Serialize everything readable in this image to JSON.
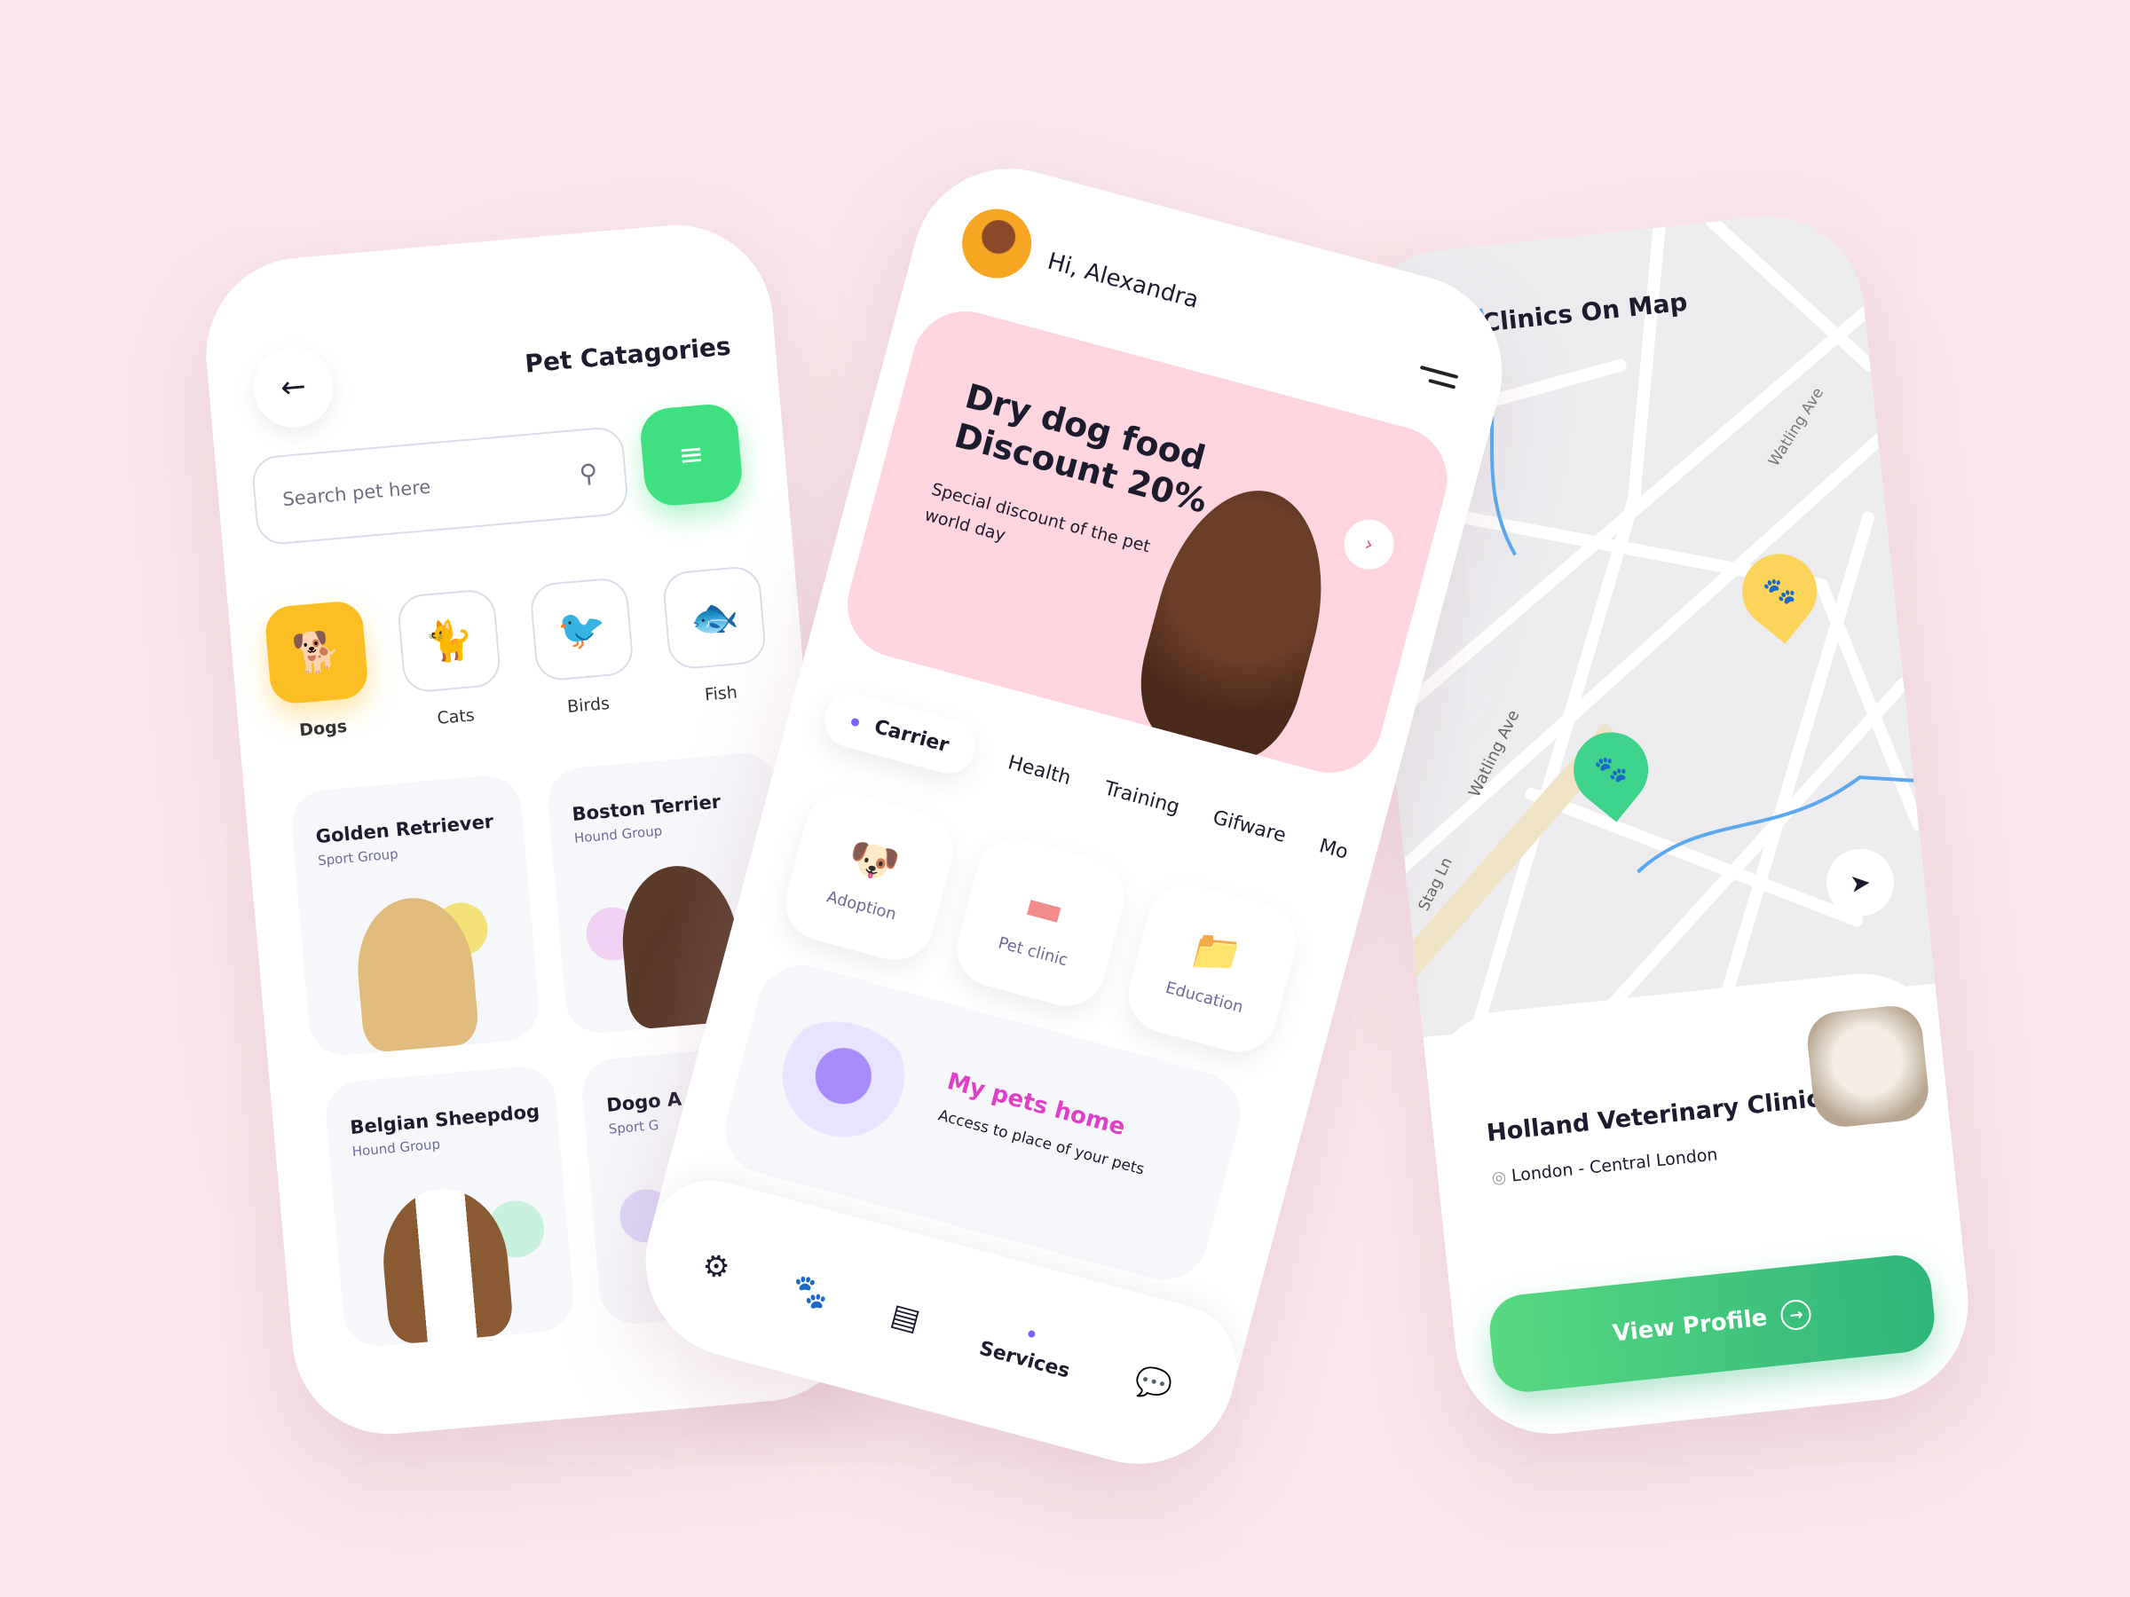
{
  "categories_screen": {
    "title": "Pet Catagories",
    "search_placeholder": "Search pet here",
    "categories": [
      {
        "label": "Dogs",
        "icon": "dog-icon",
        "active": true
      },
      {
        "label": "Cats",
        "icon": "cat-icon",
        "active": false
      },
      {
        "label": "Birds",
        "icon": "bird-icon",
        "active": false
      },
      {
        "label": "Fish",
        "icon": "fish-icon",
        "active": false
      }
    ],
    "pets": [
      {
        "name": "Golden Retriever",
        "group": "Sport Group"
      },
      {
        "name": "Boston Terrier",
        "group": "Hound Group"
      },
      {
        "name": "Belgian Sheepdog",
        "group": "Hound Group"
      },
      {
        "name": "Dogo A",
        "group": "Sport G"
      }
    ]
  },
  "home_screen": {
    "greeting": "Hi, Alexandra",
    "banner": {
      "title_line1": "Dry dog food",
      "title_line2": "Discount 20%",
      "subtitle": "Special discount of the pet world day"
    },
    "tabs": [
      "Carrier",
      "Health",
      "Training",
      "Gifware",
      "Mo"
    ],
    "services": [
      {
        "label": "Adoption",
        "icon": "dog-toy-icon"
      },
      {
        "label": "Pet clinic",
        "icon": "bandage-icon"
      },
      {
        "label": "Education",
        "icon": "folder-icon"
      }
    ],
    "promo": {
      "title": "My pets home",
      "subtitle": "Access to place of your pets"
    },
    "nav": {
      "active_label": "Services"
    }
  },
  "map_screen": {
    "title": "Clinics On Map",
    "roads": [
      "Watling Ave",
      "Watling Ave",
      "Stag Ln"
    ],
    "clinic_name": "Holland Veterinary Clinic",
    "clinic_location": "London - Central London",
    "button_label": "View Profile"
  },
  "colors": {
    "background": "#f9e6ea",
    "green": "#3ee07f",
    "yellow": "#fbbf24",
    "pink": "#ffd6e0",
    "accent_purple": "#7b61ff",
    "magenta": "#e040c8"
  }
}
